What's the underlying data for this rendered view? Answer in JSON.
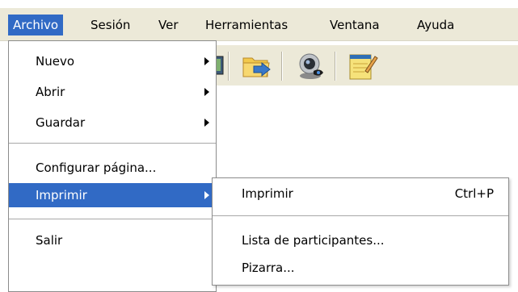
{
  "menubar": {
    "items": [
      {
        "label": "Archivo",
        "active": true
      },
      {
        "label": "Sesión",
        "active": false
      },
      {
        "label": "Ver",
        "active": false
      },
      {
        "label": "Herramientas",
        "active": false
      },
      {
        "label": "Ventana",
        "active": false
      },
      {
        "label": "Ayuda",
        "active": false
      }
    ]
  },
  "archivo_menu": {
    "items": [
      {
        "label": "Nuevo",
        "has_submenu": true
      },
      {
        "label": "Abrir",
        "has_submenu": true
      },
      {
        "label": "Guardar",
        "has_submenu": true
      },
      {
        "label": "Configurar página...",
        "has_submenu": false
      },
      {
        "label": "Imprimir",
        "has_submenu": true,
        "highlighted": true
      },
      {
        "label": "Salir",
        "has_submenu": false
      }
    ]
  },
  "imprimir_submenu": {
    "items": [
      {
        "label": "Imprimir",
        "shortcut": "Ctrl+P"
      },
      {
        "label": "Lista de participantes...",
        "shortcut": ""
      },
      {
        "label": "Pizarra...",
        "shortcut": ""
      }
    ]
  },
  "toolbar": {
    "icons": [
      "screen-icon",
      "folder-send-icon",
      "webcam-icon",
      "notepad-icon"
    ]
  },
  "colors": {
    "highlight": "#316ac5",
    "menubar_bg": "#ece9d8"
  }
}
